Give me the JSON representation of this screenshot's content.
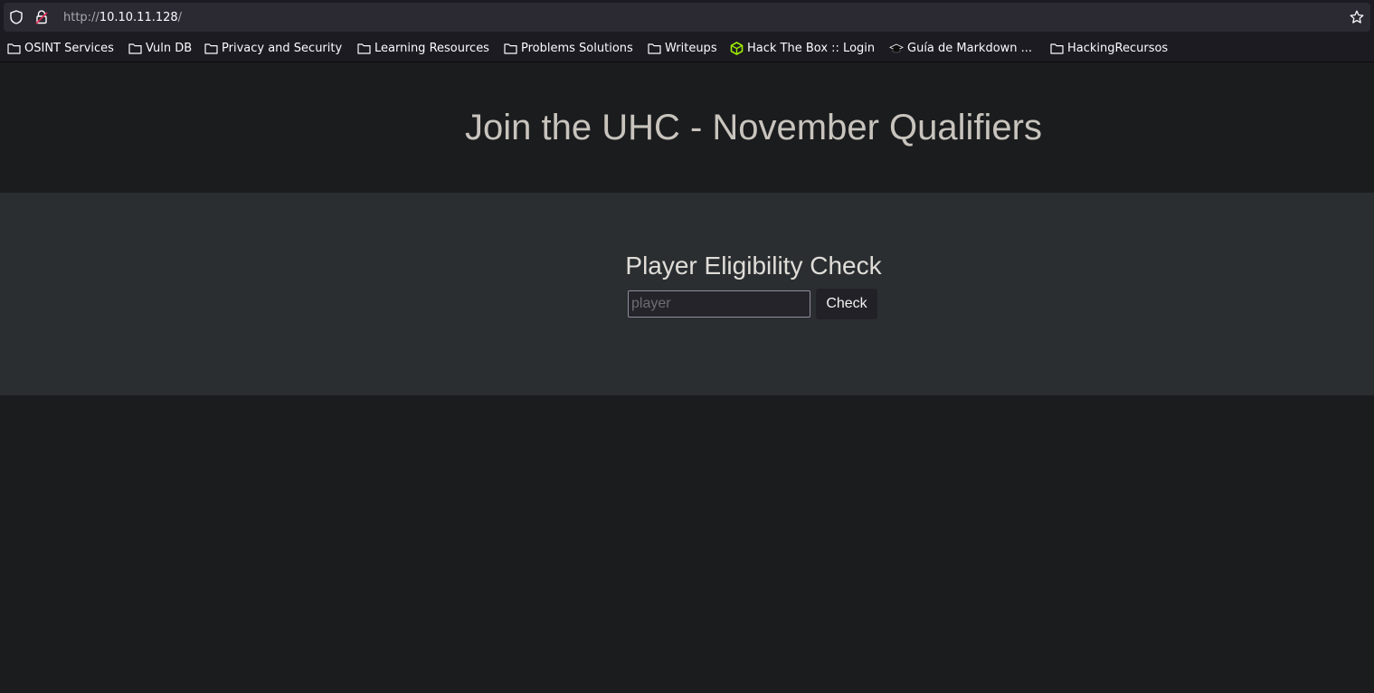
{
  "browser": {
    "url_scheme": "http://",
    "url_host": "10.10.11.128",
    "url_path": "/",
    "bookmarks": [
      {
        "label": "OSINT Services",
        "icon": "folder-icon"
      },
      {
        "label": "Vuln DB",
        "icon": "folder-icon"
      },
      {
        "label": "Privacy and Security",
        "icon": "folder-icon"
      },
      {
        "label": "Learning Resources",
        "icon": "folder-icon"
      },
      {
        "label": "Problems Solutions",
        "icon": "folder-icon"
      },
      {
        "label": "Writeups",
        "icon": "folder-icon"
      },
      {
        "label": "Hack The Box :: Login",
        "icon": "htb-cube-icon"
      },
      {
        "label": "Guía de Markdown ...",
        "icon": "graduation-cap-icon"
      },
      {
        "label": "HackingRecursos",
        "icon": "folder-icon"
      }
    ]
  },
  "page": {
    "title": "Join the UHC - November Qualifiers",
    "check_section": {
      "heading": "Player Eligibility Check",
      "input_placeholder": "player",
      "button_label": "Check"
    }
  },
  "colors": {
    "page_bg": "#1b1c1e",
    "band_bg": "#2a2e31",
    "htb_green": "#9fef00"
  }
}
